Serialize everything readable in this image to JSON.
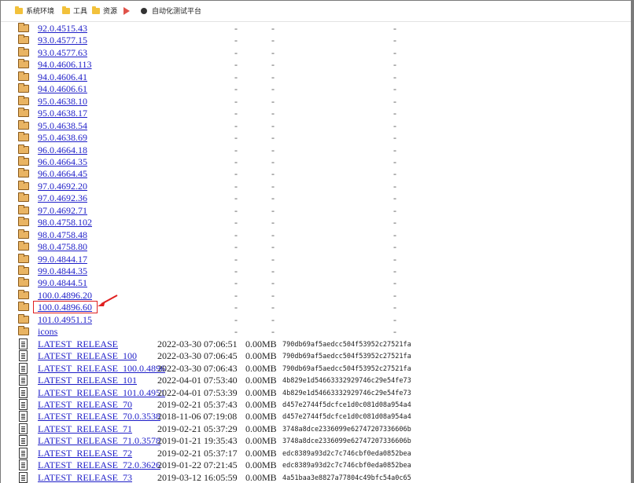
{
  "bookmarks": [
    {
      "label": "系统环境",
      "icon": "folder-icon"
    },
    {
      "label": "工具",
      "icon": "folder-icon"
    },
    {
      "label": "资源",
      "icon": "folder-icon"
    },
    {
      "label": "",
      "icon": "play-icon"
    },
    {
      "label": "自动化测试平台",
      "icon": "circle-icon"
    }
  ],
  "entries": [
    {
      "type": "folder",
      "name": "92.0.4515.43",
      "date": "",
      "size": "",
      "hash": "",
      "dash": "-"
    },
    {
      "type": "folder",
      "name": "93.0.4577.15",
      "date": "",
      "size": "",
      "hash": "",
      "dash": "-"
    },
    {
      "type": "folder",
      "name": "93.0.4577.63",
      "date": "",
      "size": "",
      "hash": "",
      "dash": "-"
    },
    {
      "type": "folder",
      "name": "94.0.4606.113",
      "date": "",
      "size": "",
      "hash": "",
      "dash": "-"
    },
    {
      "type": "folder",
      "name": "94.0.4606.41",
      "date": "",
      "size": "",
      "hash": "",
      "dash": "-"
    },
    {
      "type": "folder",
      "name": "94.0.4606.61",
      "date": "",
      "size": "",
      "hash": "",
      "dash": "-"
    },
    {
      "type": "folder",
      "name": "95.0.4638.10",
      "date": "",
      "size": "",
      "hash": "",
      "dash": "-"
    },
    {
      "type": "folder",
      "name": "95.0.4638.17",
      "date": "",
      "size": "",
      "hash": "",
      "dash": "-"
    },
    {
      "type": "folder",
      "name": "95.0.4638.54",
      "date": "",
      "size": "",
      "hash": "",
      "dash": "-"
    },
    {
      "type": "folder",
      "name": "95.0.4638.69",
      "date": "",
      "size": "",
      "hash": "",
      "dash": "-"
    },
    {
      "type": "folder",
      "name": "96.0.4664.18",
      "date": "",
      "size": "",
      "hash": "",
      "dash": "-"
    },
    {
      "type": "folder",
      "name": "96.0.4664.35",
      "date": "",
      "size": "",
      "hash": "",
      "dash": "-"
    },
    {
      "type": "folder",
      "name": "96.0.4664.45",
      "date": "",
      "size": "",
      "hash": "",
      "dash": "-"
    },
    {
      "type": "folder",
      "name": "97.0.4692.20",
      "date": "",
      "size": "",
      "hash": "",
      "dash": "-"
    },
    {
      "type": "folder",
      "name": "97.0.4692.36",
      "date": "",
      "size": "",
      "hash": "",
      "dash": "-"
    },
    {
      "type": "folder",
      "name": "97.0.4692.71",
      "date": "",
      "size": "",
      "hash": "",
      "dash": "-"
    },
    {
      "type": "folder",
      "name": "98.0.4758.102",
      "date": "",
      "size": "",
      "hash": "",
      "dash": "-"
    },
    {
      "type": "folder",
      "name": "98.0.4758.48",
      "date": "",
      "size": "",
      "hash": "",
      "dash": "-"
    },
    {
      "type": "folder",
      "name": "98.0.4758.80",
      "date": "",
      "size": "",
      "hash": "",
      "dash": "-"
    },
    {
      "type": "folder",
      "name": "99.0.4844.17",
      "date": "",
      "size": "",
      "hash": "",
      "dash": "-"
    },
    {
      "type": "folder",
      "name": "99.0.4844.35",
      "date": "",
      "size": "",
      "hash": "",
      "dash": "-"
    },
    {
      "type": "folder",
      "name": "99.0.4844.51",
      "date": "",
      "size": "",
      "hash": "",
      "dash": "-"
    },
    {
      "type": "folder",
      "name": "100.0.4896.20",
      "date": "",
      "size": "",
      "hash": "",
      "dash": "-"
    },
    {
      "type": "folder",
      "name": "100.0.4896.60",
      "date": "",
      "size": "",
      "hash": "",
      "dash": "-",
      "highlighted": true
    },
    {
      "type": "folder",
      "name": "101.0.4951.15",
      "date": "",
      "size": "",
      "hash": "",
      "dash": "-"
    },
    {
      "type": "folder",
      "name": "icons",
      "date": "",
      "size": "",
      "hash": "",
      "dash": "-"
    },
    {
      "type": "file",
      "name": "LATEST_RELEASE",
      "date": "2022-03-30 07:06:51",
      "size": "0.00MB",
      "hash": "790db69af5aedcc504f53952c27521fa",
      "dash": ""
    },
    {
      "type": "file",
      "name": "LATEST_RELEASE_100",
      "date": "2022-03-30 07:06:45",
      "size": "0.00MB",
      "hash": "790db69af5aedcc504f53952c27521fa",
      "dash": ""
    },
    {
      "type": "file",
      "name": "LATEST_RELEASE_100.0.4896",
      "date": "2022-03-30 07:06:43",
      "size": "0.00MB",
      "hash": "790db69af5aedcc504f53952c27521fa",
      "dash": ""
    },
    {
      "type": "file",
      "name": "LATEST_RELEASE_101",
      "date": "2022-04-01 07:53:40",
      "size": "0.00MB",
      "hash": "4b829e1d54663332929746c29e54fe73",
      "dash": ""
    },
    {
      "type": "file",
      "name": "LATEST_RELEASE_101.0.4951",
      "date": "2022-04-01 07:53:39",
      "size": "0.00MB",
      "hash": "4b829e1d54663332929746c29e54fe73",
      "dash": ""
    },
    {
      "type": "file",
      "name": "LATEST_RELEASE_70",
      "date": "2019-02-21 05:37:43",
      "size": "0.00MB",
      "hash": "d457e2744f5dcfce1d0c081d08a954a4",
      "dash": ""
    },
    {
      "type": "file",
      "name": "LATEST_RELEASE_70.0.3538",
      "date": "2018-11-06 07:19:08",
      "size": "0.00MB",
      "hash": "d457e2744f5dcfce1d0c081d08a954a4",
      "dash": ""
    },
    {
      "type": "file",
      "name": "LATEST_RELEASE_71",
      "date": "2019-02-21 05:37:29",
      "size": "0.00MB",
      "hash": "3748a8dce2336099e62747207336606b",
      "dash": ""
    },
    {
      "type": "file",
      "name": "LATEST_RELEASE_71.0.3578",
      "date": "2019-01-21 19:35:43",
      "size": "0.00MB",
      "hash": "3748a8dce2336099e62747207336606b",
      "dash": ""
    },
    {
      "type": "file",
      "name": "LATEST_RELEASE_72",
      "date": "2019-02-21 05:37:17",
      "size": "0.00MB",
      "hash": "edc8389a93d2c7c746cbf0eda0852bea",
      "dash": ""
    },
    {
      "type": "file",
      "name": "LATEST_RELEASE_72.0.3626",
      "date": "2019-01-22 07:21:45",
      "size": "0.00MB",
      "hash": "edc8389a93d2c7c746cbf0eda0852bea",
      "dash": ""
    },
    {
      "type": "file",
      "name": "LATEST_RELEASE_73",
      "date": "2019-03-12 16:05:59",
      "size": "0.00MB",
      "hash": "4a51baa3e8827a77804c49bfc54a0c65",
      "dash": ""
    }
  ],
  "colors": {
    "link": "#1e1ec8",
    "highlight": "#e02020",
    "folder": "#e9b463"
  }
}
